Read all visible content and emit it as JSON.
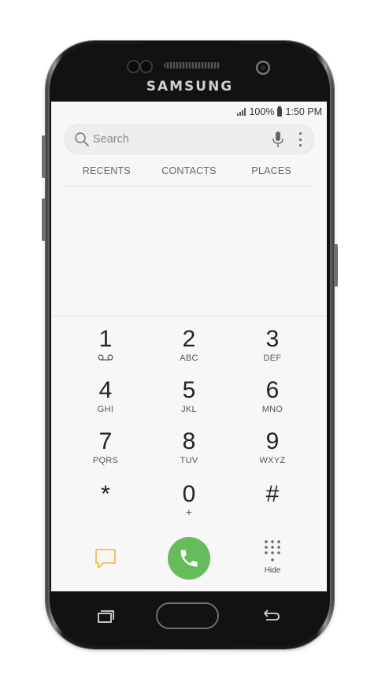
{
  "device": {
    "brand": "SAMSUNG"
  },
  "status_bar": {
    "battery": "100%",
    "time": "1:50 PM"
  },
  "search": {
    "placeholder": "Search"
  },
  "tabs": [
    {
      "label": "RECENTS"
    },
    {
      "label": "CONTACTS"
    },
    {
      "label": "PLACES"
    }
  ],
  "keypad": {
    "keys": [
      {
        "digit": "1",
        "letters": ""
      },
      {
        "digit": "2",
        "letters": "ABC"
      },
      {
        "digit": "3",
        "letters": "DEF"
      },
      {
        "digit": "4",
        "letters": "GHI"
      },
      {
        "digit": "5",
        "letters": "JKL"
      },
      {
        "digit": "6",
        "letters": "MNO"
      },
      {
        "digit": "7",
        "letters": "PQRS"
      },
      {
        "digit": "8",
        "letters": "TUV"
      },
      {
        "digit": "9",
        "letters": "WXYZ"
      },
      {
        "digit": "*",
        "letters": ""
      },
      {
        "digit": "0",
        "letters": "+"
      },
      {
        "digit": "#",
        "letters": ""
      }
    ]
  },
  "actions": {
    "hide_label": "Hide"
  },
  "colors": {
    "call_button": "#66bb5a",
    "message_icon": "#f2b53b",
    "screen_bg": "#f7f7f7"
  },
  "icons": [
    "search-icon",
    "mic-icon",
    "more-options-icon",
    "voicemail-icon",
    "message-icon",
    "phone-icon",
    "dialpad-dots-icon",
    "recent-apps-icon",
    "back-icon"
  ]
}
